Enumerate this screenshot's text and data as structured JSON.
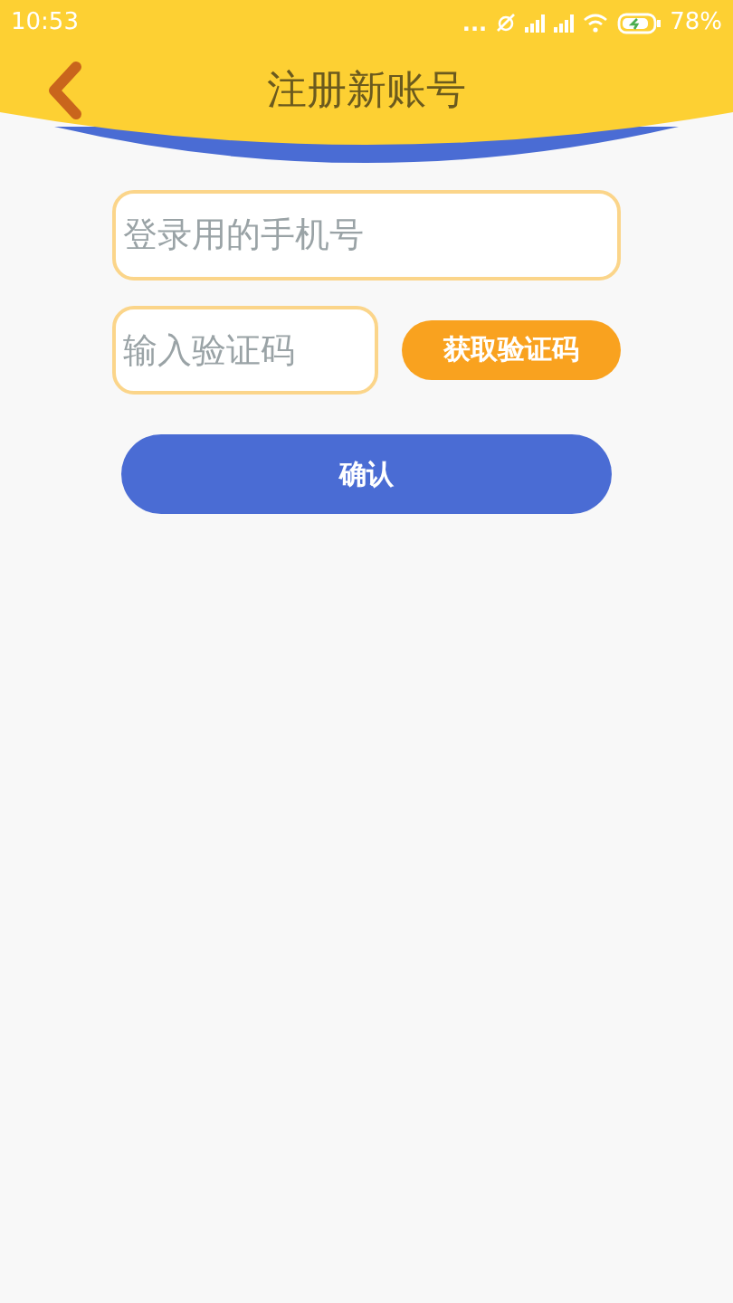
{
  "status_bar": {
    "time": "10:53",
    "dots": "...",
    "battery": "78%"
  },
  "header": {
    "title": "注册新账号"
  },
  "phone_field": {
    "placeholder": "登录用的手机号"
  },
  "code_field": {
    "placeholder": "输入验证码"
  },
  "get_code_button": {
    "label": "获取验证码"
  },
  "confirm_button": {
    "label": "确认"
  }
}
